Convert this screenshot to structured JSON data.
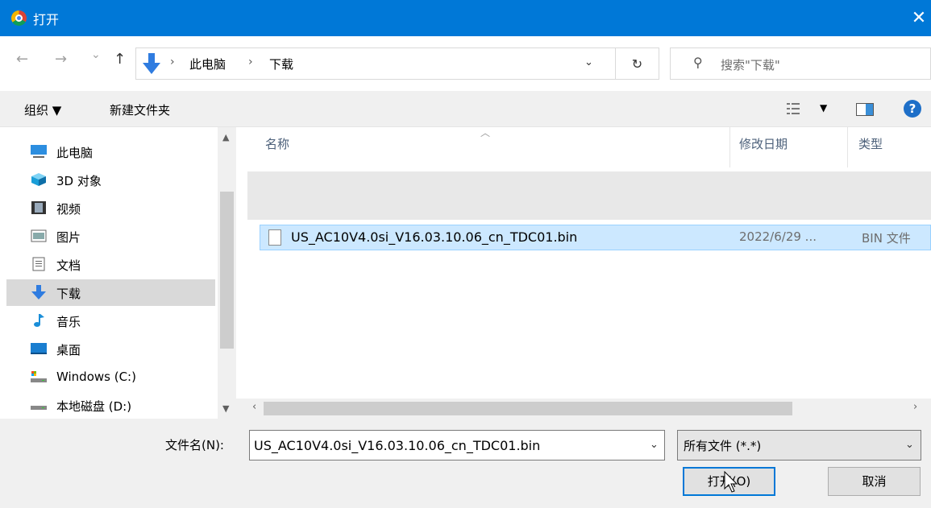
{
  "window": {
    "title": "打开",
    "close_glyph": "✕"
  },
  "nav": {
    "back": "←",
    "forward": "→",
    "recent": "⌄",
    "up": "↑"
  },
  "address": {
    "sep": "›",
    "crumbs": [
      "此电脑",
      "下载"
    ],
    "dropdown": "⌄",
    "refresh": "↻"
  },
  "search": {
    "placeholder": "搜索\"下载\"",
    "icon": "search-icon"
  },
  "toolbar": {
    "organize": "组织 ▼",
    "new_folder": "新建文件夹"
  },
  "sidebar": {
    "items": [
      {
        "label": "此电脑",
        "icon": "computer-icon"
      },
      {
        "label": "3D 对象",
        "icon": "cube-icon"
      },
      {
        "label": "视频",
        "icon": "video-icon"
      },
      {
        "label": "图片",
        "icon": "picture-icon"
      },
      {
        "label": "文档",
        "icon": "document-icon"
      },
      {
        "label": "下载",
        "icon": "download-icon",
        "selected": true
      },
      {
        "label": "音乐",
        "icon": "music-icon"
      },
      {
        "label": "桌面",
        "icon": "desktop-icon"
      },
      {
        "label": "Windows (C:)",
        "icon": "drive-icon"
      },
      {
        "label": "本地磁盘 (D:)",
        "icon": "drive-icon"
      }
    ]
  },
  "files": {
    "columns": {
      "name": "名称",
      "modified": "修改日期",
      "type": "类型"
    },
    "rows": [
      {
        "name": "US_AC10V4.0si_V16.03.10.06_cn_TDC01.bin",
        "modified": "2022/6/29 ...",
        "type": "BIN 文件",
        "selected": true
      }
    ]
  },
  "bottom": {
    "filename_label": "文件名(N):",
    "filename_value": "US_AC10V4.0si_V16.03.10.06_cn_TDC01.bin",
    "filetype": "所有文件 (*.*)",
    "open_button": "打开(O)",
    "cancel_button": "取消"
  },
  "colors": {
    "accent": "#0078d7",
    "selection": "#cce8ff",
    "selection_border": "#99d1ff"
  }
}
